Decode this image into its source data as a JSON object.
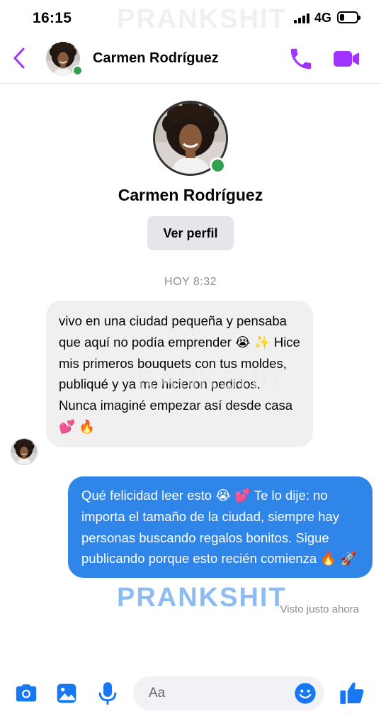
{
  "status_bar": {
    "time": "16:15",
    "network": "4G",
    "watermark": "PRANKSHIT",
    "battery_level": 0.25
  },
  "header": {
    "contact_name": "Carmen Rodríguez",
    "online": true,
    "icons": [
      "back-chevron-icon",
      "phone-icon",
      "video-camera-icon"
    ]
  },
  "profile": {
    "name": "Carmen Rodríguez",
    "view_profile_label": "Ver perfil"
  },
  "conversation": {
    "timestamp": "HOY 8:32",
    "messages": [
      {
        "direction": "incoming",
        "text": "vivo en una ciudad pequeña y pensaba que aquí no podía emprender 😭 ✨  Hice mis primeros bouquets con tus moldes, publiqué y ya me hicieron pedidos. Nunca imaginé empezar así desde casa 💕 🔥"
      },
      {
        "direction": "outgoing",
        "text": "Qué felicidad leer esto 😭 💕  Te lo dije: no importa el tamaño de la ciudad, siempre hay personas buscando regalos bonitos. Sigue publicando porque esto recién comienza 🔥 🚀"
      }
    ],
    "seen_status": "Visto justo ahora"
  },
  "composer": {
    "placeholder": "Aa",
    "icons": [
      "camera-icon",
      "image-gallery-icon",
      "microphone-icon",
      "emoji-icon",
      "thumbs-up-icon"
    ]
  },
  "colors": {
    "accent_purple": "#a033ff",
    "outgoing_bubble": "#2f86e8",
    "incoming_bubble": "#f0f0f0",
    "composer_blue": "#1877f2",
    "online_green": "#31a24c"
  }
}
